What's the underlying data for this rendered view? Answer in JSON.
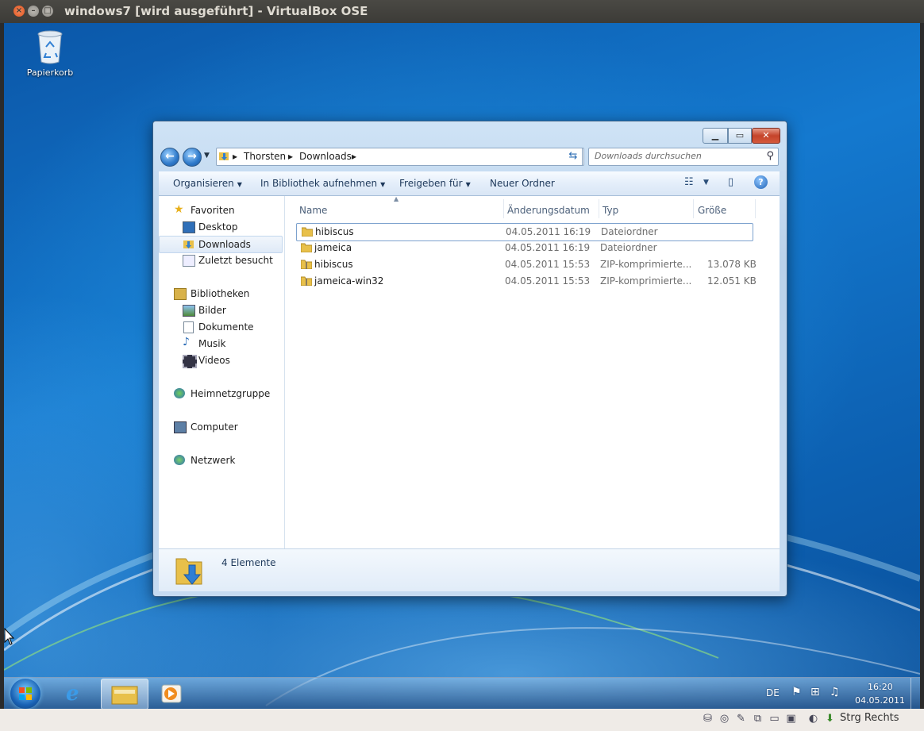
{
  "host": {
    "title": "windows7 [wird ausgeführt] - VirtualBox OSE",
    "status_label": "Strg Rechts"
  },
  "desktop": {
    "recycle_bin_label": "Papierkorb"
  },
  "explorer": {
    "breadcrumb": [
      "Thorsten",
      "Downloads"
    ],
    "search_placeholder": "Downloads durchsuchen",
    "toolbar": {
      "organize": "Organisieren",
      "add_library": "In Bibliothek aufnehmen",
      "share": "Freigeben für",
      "new_folder": "Neuer Ordner"
    },
    "nav": {
      "favorites": "Favoriten",
      "desktop": "Desktop",
      "downloads": "Downloads",
      "recent": "Zuletzt besucht",
      "libraries": "Bibliotheken",
      "pictures": "Bilder",
      "documents": "Dokumente",
      "music": "Musik",
      "videos": "Videos",
      "homegroup": "Heimnetzgruppe",
      "computer": "Computer",
      "network": "Netzwerk"
    },
    "columns": {
      "name": "Name",
      "date": "Änderungsdatum",
      "type": "Typ",
      "size": "Größe"
    },
    "files": [
      {
        "name": "hibiscus",
        "date": "04.05.2011 16:19",
        "type": "Dateiordner",
        "size": "",
        "kind": "folder"
      },
      {
        "name": "jameica",
        "date": "04.05.2011 16:19",
        "type": "Dateiordner",
        "size": "",
        "kind": "folder"
      },
      {
        "name": "hibiscus",
        "date": "04.05.2011 15:53",
        "type": "ZIP-komprimierte...",
        "size": "13.078 KB",
        "kind": "zip"
      },
      {
        "name": "jameica-win32",
        "date": "04.05.2011 15:53",
        "type": "ZIP-komprimierte...",
        "size": "12.051 KB",
        "kind": "zip"
      }
    ],
    "status_count": "4 Elemente"
  },
  "taskbar": {
    "language": "DE",
    "time": "16:20",
    "date": "04.05.2011"
  },
  "colors": {
    "host_titlebar": "#3c3b37",
    "desktop_blue": "#1479cf",
    "close_red": "#c4432a",
    "folder_yellow": "#e8c04a"
  }
}
